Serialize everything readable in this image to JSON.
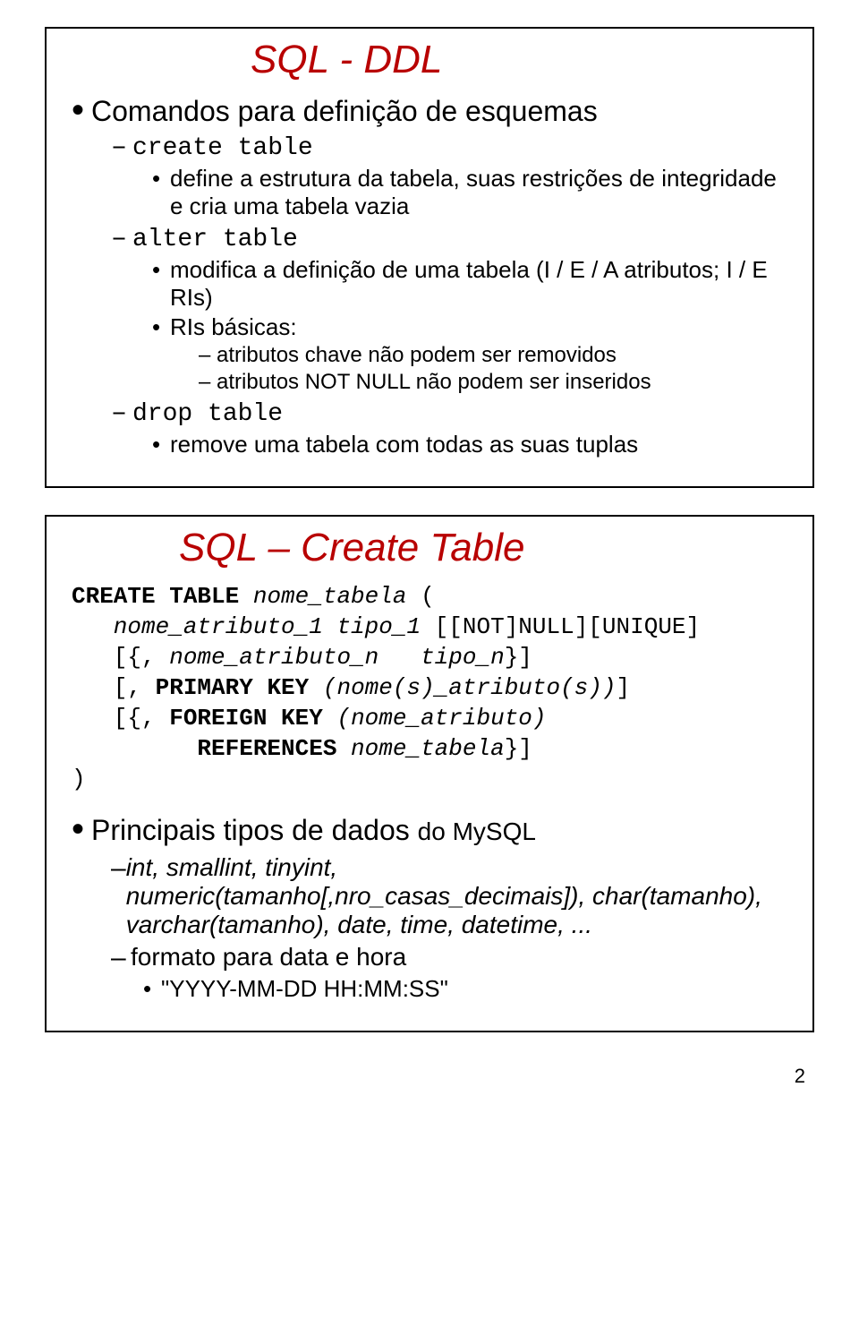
{
  "slide1": {
    "title": "SQL - DDL",
    "b1": "Comandos para definição de esquemas",
    "ct": "create table",
    "ct_desc": "define a estrutura da tabela, suas restrições de integridade e cria uma tabela vazia",
    "at": "alter table",
    "at_desc": "modifica a definição de uma tabela (I / E / A atributos; I / E RIs)",
    "at_ris": "RIs básicas:",
    "at_ris1": "atributos chave não podem ser removidos",
    "at_ris2": "atributos NOT NULL não podem ser inseridos",
    "dt": "drop table",
    "dt_desc": "remove uma tabela com todas as suas tuplas"
  },
  "slide2": {
    "title": "SQL – Create Table",
    "code": {
      "l1a": "CREATE TABLE",
      "l1b": " nome_tabela",
      "l1c": " (",
      "l2a": "   nome_atributo_1 tipo_1",
      "l2b": " [[NOT]NULL][UNIQUE]",
      "l3a": "   [{, ",
      "l3b": "nome_atributo_n   tipo_n",
      "l3c": "}]",
      "l4a": "   [, ",
      "l4b": "PRIMARY KEY",
      "l4c": " (nome(s)_atributo(s))",
      "l4d": "]",
      "l5a": "   [{, ",
      "l5b": "FOREIGN KEY",
      "l5c": " (nome_atributo)",
      "l6a": "         REFERENCES",
      "l6b": " nome_tabela",
      "l6c": "}]",
      "l7": ")"
    },
    "b1": "Principais tipos de dados ",
    "b1sfx": "do MySQL",
    "types1": "int, smallint, tinyint, numeric(tamanho[,nro_casas_decimais]), char(tamanho), varchar(tamanho), date, time, datetime, ...",
    "fmt": "formato para data e hora",
    "fmt_ex": "\"YYYY-MM-DD HH:MM:SS\""
  },
  "pagenum": "2"
}
